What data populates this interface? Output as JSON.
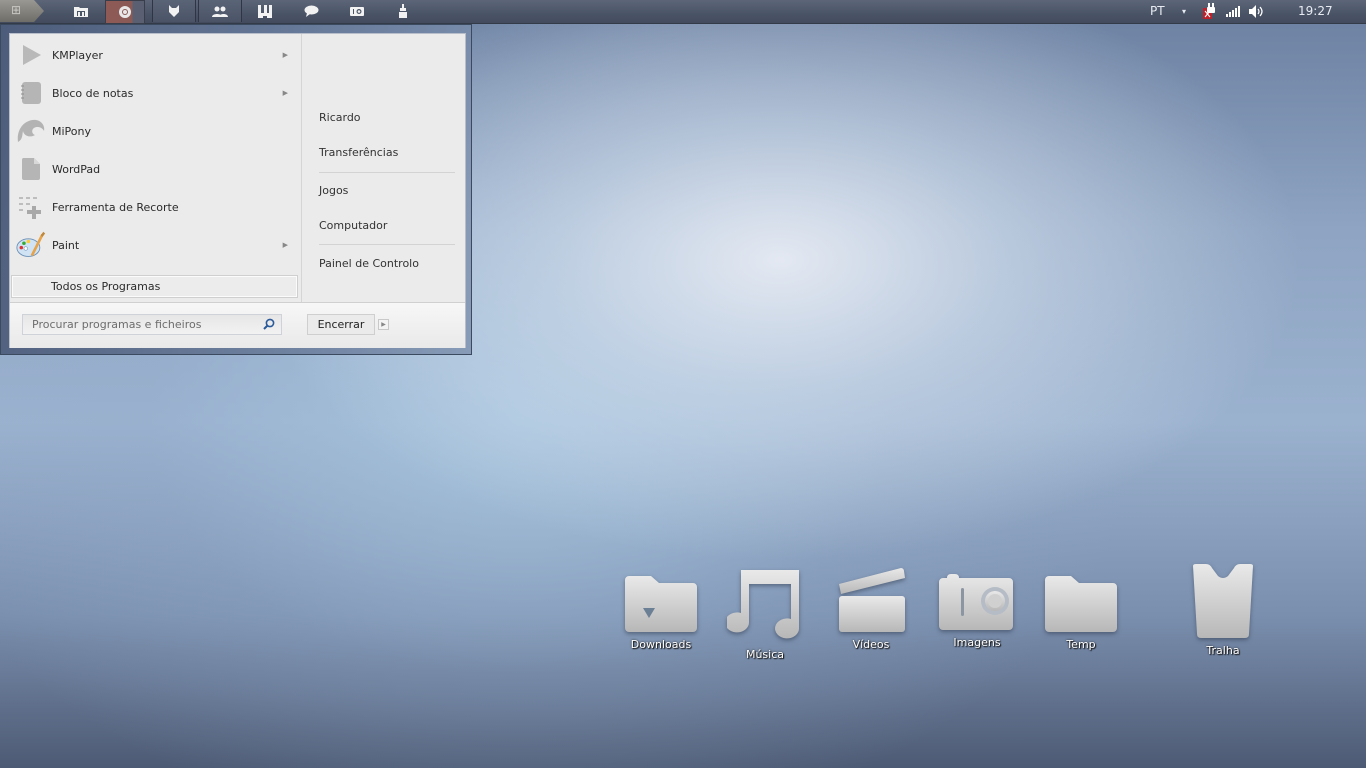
{
  "taskbar": {
    "start_button": {
      "icon": "windows-flag-icon"
    },
    "pinned": [
      {
        "name": "explorer",
        "icon": "folder-icon",
        "glyph": "▭"
      },
      {
        "name": "chrome",
        "icon": "chrome-icon",
        "glyph": "◉",
        "active": true
      },
      {
        "name": "firefox",
        "icon": "fox-icon",
        "glyph": "♥"
      },
      {
        "name": "contacts",
        "icon": "users-icon",
        "glyph": "👥"
      },
      {
        "name": "utorrent",
        "icon": "utorrent-icon",
        "glyph": "µ"
      },
      {
        "name": "messenger",
        "icon": "chat-bubble-icon",
        "glyph": "💬"
      },
      {
        "name": "camera",
        "icon": "camera-icon",
        "glyph": "▣"
      },
      {
        "name": "cleaner",
        "icon": "brush-icon",
        "glyph": "▮"
      }
    ],
    "tray": {
      "language": "PT",
      "overflow_arrow": "▾",
      "battery": "battery-plug-icon",
      "network": "signal-bars-icon",
      "volume": "speaker-icon",
      "clock": "19:27"
    }
  },
  "start_menu": {
    "programs": [
      {
        "label": "KMPlayer",
        "icon": "play-icon",
        "has_submenu": true
      },
      {
        "label": "Bloco de notas",
        "icon": "notepad-icon",
        "has_submenu": true
      },
      {
        "label": "MiPony",
        "icon": "mipony-icon",
        "has_submenu": false
      },
      {
        "label": "WordPad",
        "icon": "document-icon",
        "has_submenu": false
      },
      {
        "label": "Ferramenta de Recorte",
        "icon": "snipping-tool-icon",
        "has_submenu": false
      },
      {
        "label": "Paint",
        "icon": "palette-icon",
        "has_submenu": true
      }
    ],
    "submenu_arrow": "▶",
    "all_programs": "Todos os Programas",
    "places": [
      {
        "label": "Ricardo"
      },
      {
        "label": "Transferências"
      },
      {
        "label": "Jogos"
      },
      {
        "label": "Computador"
      },
      {
        "label": "Painel de Controlo"
      }
    ],
    "search_placeholder": "Procurar programas e ficheiros",
    "search_icon": "⚲",
    "shutdown_label": "Encerrar",
    "shutdown_arrow": "▶"
  },
  "desktop": {
    "icons": [
      {
        "label": "Downloads",
        "icon": "downloads-folder-icon"
      },
      {
        "label": "Música",
        "icon": "music-note-icon"
      },
      {
        "label": "Vídeos",
        "icon": "clapperboard-icon"
      },
      {
        "label": "Imagens",
        "icon": "camera-icon"
      },
      {
        "label": "Temp",
        "icon": "folder-icon"
      },
      {
        "label": "Tralha",
        "icon": "trash-bin-icon"
      }
    ]
  }
}
